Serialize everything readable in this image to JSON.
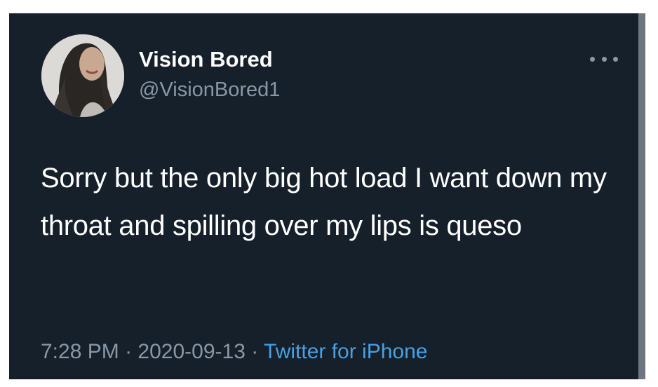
{
  "tweet": {
    "author_name": "Vision Bored",
    "author_handle": "@VisionBored1",
    "more_icon": "more-horizontal-icon",
    "avatar_icon": "profile-photo",
    "text": "Sorry but the only big hot load I want down my throat and spilling over my lips is queso",
    "time": "7:28 PM",
    "separator": "·",
    "date": "2020-09-13",
    "source": "Twitter for iPhone"
  },
  "colors": {
    "background": "#15202b",
    "name": "#ffffff",
    "secondary": "#8a98a6",
    "link": "#4a9fe3"
  }
}
